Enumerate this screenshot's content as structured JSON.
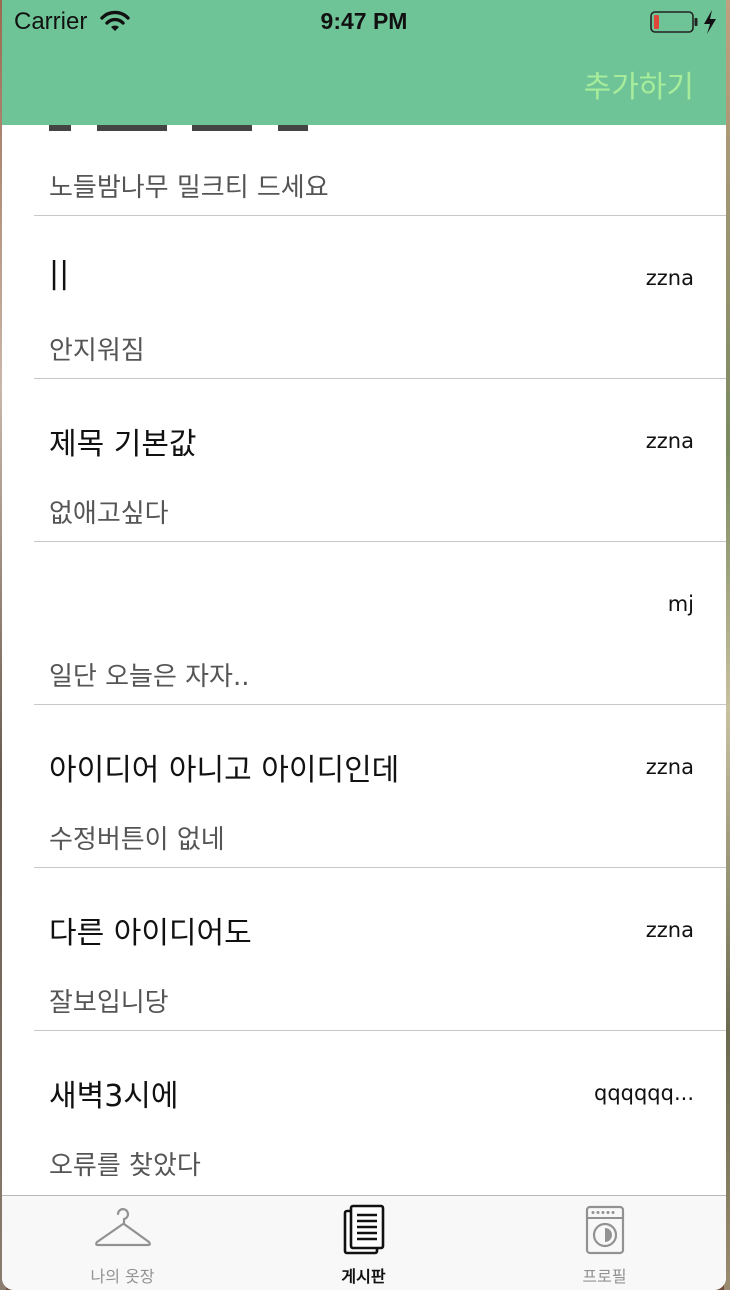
{
  "status_bar": {
    "carrier": "Carrier",
    "time": "9:47 PM"
  },
  "header": {
    "add_label": "추가하기"
  },
  "posts": [
    {
      "title": "",
      "author": "",
      "content": "노들밤나무 밀크티 드세요"
    },
    {
      "title": "||",
      "author": "zzna",
      "content": "안지워짐"
    },
    {
      "title": "제목 기본값",
      "author": "zzna",
      "content": "없애고싶다"
    },
    {
      "title": "",
      "author": "mj",
      "content": "일단 오늘은 자자.."
    },
    {
      "title": "아이디어 아니고 아이디인데",
      "author": "zzna",
      "content": "수정버튼이 없네"
    },
    {
      "title": "다른 아이디어도",
      "author": "zzna",
      "content": "잘보입니당"
    },
    {
      "title": "새벽3시에",
      "author": "qqqqqq...",
      "content": "오류를 찾았다"
    }
  ],
  "tabbar": {
    "tabs": [
      {
        "label": "나의 옷장",
        "icon": "hanger-icon",
        "active": false
      },
      {
        "label": "게시판",
        "icon": "board-icon",
        "active": true
      },
      {
        "label": "프로필",
        "icon": "washing-machine-icon",
        "active": false
      }
    ]
  },
  "colors": {
    "header_bg": "#6fc497",
    "add_button": "#a6ec9b",
    "active_tab": "#111111",
    "inactive_tab": "#929292"
  }
}
